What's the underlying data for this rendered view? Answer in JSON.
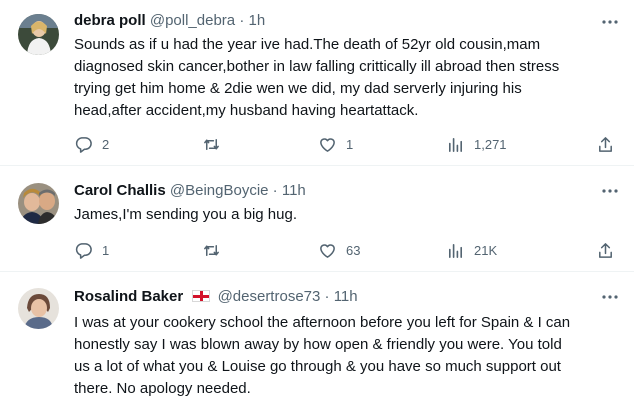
{
  "tweets": [
    {
      "name": "debra poll",
      "handle": "@poll_debra",
      "separator": "·",
      "time": "1h",
      "text": "Sounds as if u had the year ive had.The death of 52yr old cousin,mam\ndiagnosed skin cancer,bother in law falling crittically ill abroad then stress\ntrying get him home & 2die wen we did, my dad serverly injuring his\nhead,after accident,my husband having heartattack.",
      "replies": "2",
      "retweets": "",
      "likes": "1",
      "views": "1,271"
    },
    {
      "name": "Carol Challis",
      "handle": "@BeingBoycie",
      "separator": "·",
      "time": "11h",
      "text": "James,I'm sending you a big hug.",
      "replies": "1",
      "retweets": "",
      "likes": "63",
      "views": "21K"
    },
    {
      "name": "Rosalind Baker",
      "flag_icon": "england-flag-icon",
      "handle": "@desertrose73",
      "separator": "·",
      "time": "11h",
      "text": "I was at your cookery school the afternoon before you left for Spain & I can\nhonestly say I was blown away by how open & friendly you were. You told\nus a lot of what you & Louise go through & you have so much support out\nthere. No apology needed."
    }
  ],
  "icons": {
    "more": "more-horizontal-icon",
    "reply": "reply-icon",
    "retweet": "retweet-icon",
    "like": "heart-icon",
    "views": "views-icon",
    "share": "share-icon"
  },
  "colors": {
    "text": "#0f1419",
    "secondary": "#536471",
    "divider": "#eff3f4",
    "flag_red": "#d3122a"
  }
}
